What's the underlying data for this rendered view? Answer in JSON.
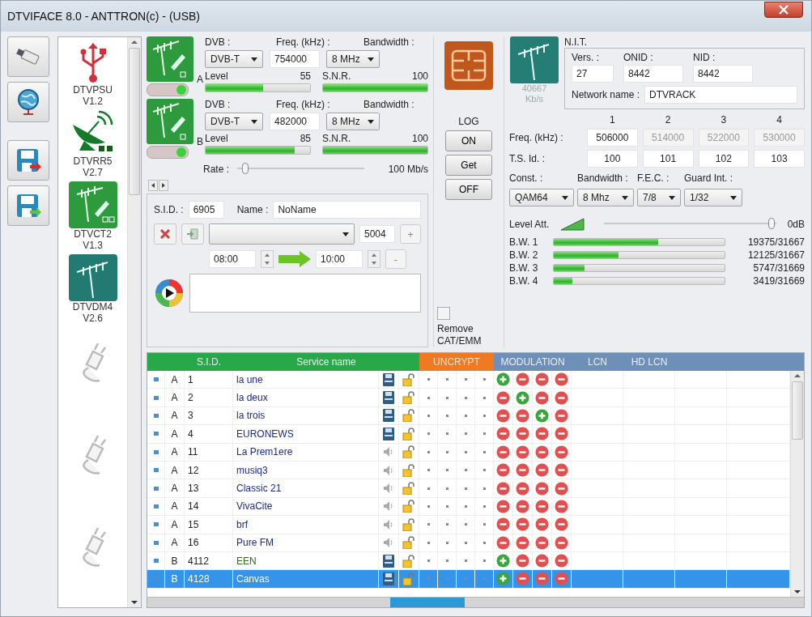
{
  "window": {
    "title": "DTVIFACE 8.0 - ANTTRON(c) - (USB)"
  },
  "modules": [
    {
      "kind": "usb",
      "name": "DTVPSU",
      "version": "V1.2"
    },
    {
      "kind": "dish",
      "name": "DTVRR5",
      "version": "V2.7"
    },
    {
      "kind": "terrestrial",
      "name": "DTVCT2",
      "version": "V1.3"
    },
    {
      "kind": "modulator",
      "name": "DTVDM4",
      "version": "V2.6"
    },
    {
      "kind": "empty"
    },
    {
      "kind": "empty"
    },
    {
      "kind": "empty"
    }
  ],
  "tuners": [
    {
      "label": "A",
      "on": true,
      "dvb_label": "DVB :",
      "freq_label": "Freq. (kHz) :",
      "bw_label": "Bandwidth :",
      "dvb": "DVB-T",
      "freq": "754000",
      "bandwidth": "8 MHz",
      "level_meter": {
        "label": "Level",
        "reading": "55",
        "level": 0.55
      },
      "snr_meter": {
        "label": "S.N.R.",
        "reading": "100",
        "level": 1
      }
    },
    {
      "label": "B",
      "on": true,
      "dvb_label": "DVB :",
      "freq_label": "Freq. (kHz) :",
      "bw_label": "Bandwidth :",
      "dvb": "DVB-T",
      "freq": "482000",
      "bandwidth": "8 MHz",
      "level_meter": {
        "label": "Level",
        "reading": "85",
        "level": 0.85
      },
      "snr_meter": {
        "label": "S.N.R.",
        "reading": "100",
        "level": 1
      }
    }
  ],
  "rate": {
    "label": "Rate :",
    "reading": "100 Mb/s",
    "level": 0.04
  },
  "service_editor": {
    "sid_label": "S.I.D. :",
    "sid": "6905",
    "name_label": "Name :",
    "name": "NoName",
    "pid": "5004",
    "plus": "+",
    "minus": "-",
    "start": "08:00",
    "end": "10:00"
  },
  "log": {
    "label": "LOG",
    "buttons": [
      "ON",
      "Get",
      "OFF"
    ],
    "remove": {
      "label": "Remove CAT/EMM",
      "checked": false
    }
  },
  "nit": {
    "rate": "40667",
    "rate_unit": "Kb/s",
    "title": "N.I.T.",
    "vers_label": "Vers. :",
    "vers": "27",
    "onid_label": "ONID :",
    "onid": "8442",
    "nid_label": "NID :",
    "nid": "8442",
    "network_name_label": "Network name :",
    "network_name": "DTVRACK"
  },
  "mux": {
    "columns": [
      "1",
      "2",
      "3",
      "4"
    ],
    "freq_label": "Freq. (kHz) :",
    "freqs": [
      {
        "value": "506000",
        "disabled": false
      },
      {
        "value": "514000",
        "disabled": true
      },
      {
        "value": "522000",
        "disabled": true
      },
      {
        "value": "530000",
        "disabled": true
      }
    ],
    "ts_label": "T.S. Id. :",
    "ts_ids": [
      "100",
      "101",
      "102",
      "103"
    ]
  },
  "params": [
    {
      "label": "Const. :",
      "value": "QAM64"
    },
    {
      "label": "Bandwidth :",
      "value": "8 Mhz"
    },
    {
      "label": "F.E.C. :",
      "value": "7/8"
    },
    {
      "label": "Guard Int. :",
      "value": "1/32"
    }
  ],
  "level_att": {
    "label": "Level Att.",
    "reading": "0dB",
    "level": 1
  },
  "bandwidths": [
    {
      "label": "B.W. 1",
      "reading": "19375/31667",
      "level": 0.61
    },
    {
      "label": "B.W. 2",
      "reading": "12125/31667",
      "level": 0.38
    },
    {
      "label": "B.W. 3",
      "reading": "5747/31669",
      "level": 0.18
    },
    {
      "label": "B.W. 4",
      "reading": "3419/31669",
      "level": 0.11
    }
  ],
  "table": {
    "header": [
      {
        "label": "S.I.D.",
        "kind": "sid"
      },
      {
        "label": "Service name",
        "kind": "name"
      },
      {
        "label": "UNCRYPT",
        "kind": "uncrypt"
      },
      {
        "label": "MODULATION",
        "kind": "modulation"
      },
      {
        "label": "LCN",
        "kind": "lcn"
      },
      {
        "label": "HD LCN",
        "kind": "hdlcn"
      }
    ],
    "rows": [
      {
        "tuner": "A",
        "sid": "1",
        "name": "la une",
        "color": "#1d2a8a",
        "kind": "tv",
        "selected": false,
        "modulation": [
          {
            "on": true
          },
          {
            "on": false
          },
          {
            "on": false
          },
          {
            "on": false
          }
        ]
      },
      {
        "tuner": "A",
        "sid": "2",
        "name": "la deux",
        "color": "#1d2a8a",
        "kind": "tv",
        "selected": false,
        "modulation": [
          {
            "on": false
          },
          {
            "on": true
          },
          {
            "on": false
          },
          {
            "on": false
          }
        ]
      },
      {
        "tuner": "A",
        "sid": "3",
        "name": "la trois",
        "color": "#1d2a8a",
        "kind": "tv",
        "selected": false,
        "modulation": [
          {
            "on": false
          },
          {
            "on": false
          },
          {
            "on": true
          },
          {
            "on": false
          }
        ]
      },
      {
        "tuner": "A",
        "sid": "4",
        "name": "EURONEWS",
        "color": "#1d2a8a",
        "kind": "tv",
        "selected": false,
        "modulation": [
          {
            "on": false
          },
          {
            "on": false
          },
          {
            "on": false
          },
          {
            "on": false
          }
        ]
      },
      {
        "tuner": "A",
        "sid": "11",
        "name": "La Prem1ere",
        "color": "#1d2a8a",
        "kind": "radio",
        "selected": false,
        "modulation": [
          {
            "on": false
          },
          {
            "on": false
          },
          {
            "on": false
          },
          {
            "on": false
          }
        ]
      },
      {
        "tuner": "A",
        "sid": "12",
        "name": "musiq3",
        "color": "#1d2a8a",
        "kind": "radio",
        "selected": false,
        "modulation": [
          {
            "on": false
          },
          {
            "on": false
          },
          {
            "on": false
          },
          {
            "on": false
          }
        ]
      },
      {
        "tuner": "A",
        "sid": "13",
        "name": "Classic 21",
        "color": "#1d2a8a",
        "kind": "radio",
        "selected": false,
        "modulation": [
          {
            "on": false
          },
          {
            "on": false
          },
          {
            "on": false
          },
          {
            "on": false
          }
        ]
      },
      {
        "tuner": "A",
        "sid": "14",
        "name": "VivaCite",
        "color": "#1d2a8a",
        "kind": "radio",
        "selected": false,
        "modulation": [
          {
            "on": false
          },
          {
            "on": false
          },
          {
            "on": false
          },
          {
            "on": false
          }
        ]
      },
      {
        "tuner": "A",
        "sid": "15",
        "name": "brf",
        "color": "#1d2a8a",
        "kind": "radio",
        "selected": false,
        "modulation": [
          {
            "on": false
          },
          {
            "on": false
          },
          {
            "on": false
          },
          {
            "on": false
          }
        ]
      },
      {
        "tuner": "A",
        "sid": "16",
        "name": "Pure FM",
        "color": "#1d2a8a",
        "kind": "radio",
        "selected": false,
        "modulation": [
          {
            "on": false
          },
          {
            "on": false
          },
          {
            "on": false
          },
          {
            "on": false
          }
        ]
      },
      {
        "tuner": "B",
        "sid": "4112",
        "name": "EEN",
        "color": "#2e6a1c",
        "kind": "tv",
        "selected": false,
        "modulation": [
          {
            "on": true
          },
          {
            "on": false
          },
          {
            "on": false
          },
          {
            "on": false
          }
        ]
      },
      {
        "tuner": "B",
        "sid": "4128",
        "name": "Canvas",
        "kind": "tv",
        "selected": true,
        "modulation": [
          {
            "on": true
          },
          {
            "on": false
          },
          {
            "on": false
          },
          {
            "on": false
          }
        ]
      }
    ]
  }
}
